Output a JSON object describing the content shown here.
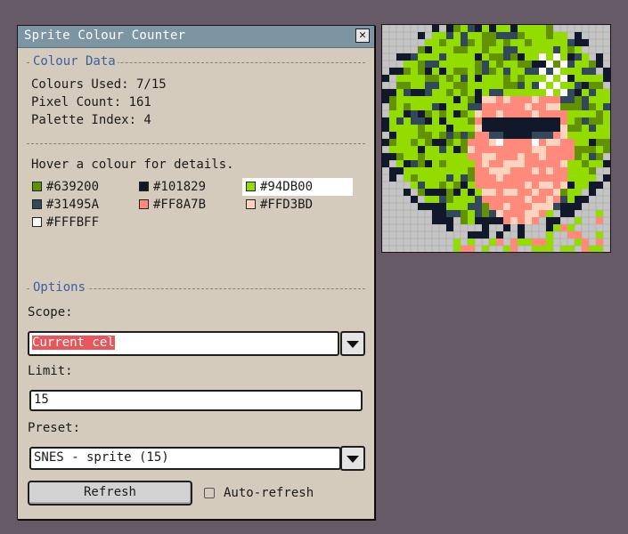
{
  "window": {
    "title": "Sprite Colour Counter"
  },
  "colour_data": {
    "heading": "Colour Data",
    "colours_used": "Colours Used: 7/15",
    "pixel_count": "Pixel Count: 161",
    "palette_index": "Palette Index: 4"
  },
  "palette": {
    "hint": "Hover a colour for details.",
    "swatches": [
      {
        "hex": "#639200",
        "label": "#639200"
      },
      {
        "hex": "#101829",
        "label": "#101829"
      },
      {
        "hex": "#94DB00",
        "label": "#94DB00"
      },
      {
        "hex": "#31495A",
        "label": "#31495A"
      },
      {
        "hex": "#FF8A7B",
        "label": "#FF8A7B"
      },
      {
        "hex": "#FFD3BD",
        "label": "#FFD3BD"
      },
      {
        "hex": "#FFFBFF",
        "label": "#FFFBFF"
      }
    ]
  },
  "options": {
    "heading": "Options",
    "scope_label": "Scope:",
    "scope_value": "Current cel",
    "limit_label": "Limit:",
    "limit_value": "15",
    "preset_label": "Preset:",
    "preset_value": "SNES - sprite (15)",
    "refresh_label": "Refresh",
    "auto_refresh_label": "Auto-refresh",
    "auto_refresh_checked": false
  },
  "colors": {
    "panel_bg": "#d4cbbd",
    "titlebar": "#7b95a3",
    "section_heading": "#3a5fa2",
    "selection": "#e8555a",
    "desktop": "#665a66"
  },
  "icons": {
    "close": "close-icon",
    "dropdown": "chevron-down-icon"
  }
}
